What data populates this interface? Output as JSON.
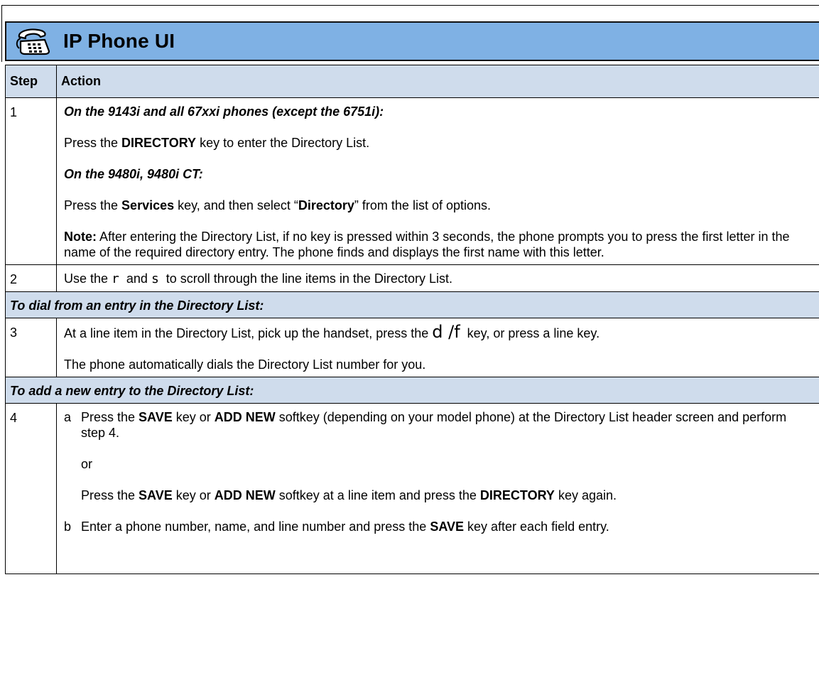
{
  "header": {
    "title": "IP Phone UI",
    "icon": "phone-icon",
    "background": "#7fb1e4"
  },
  "table": {
    "col_step": "Step",
    "col_action": "Action",
    "header_row_color": "#cfdcec"
  },
  "step1": {
    "num": "1",
    "models_a": "On the 9143i and all 67xxi phones (except the 6751i):",
    "press_a_pre": "Press the ",
    "press_a_key": "DIRECTORY",
    "press_a_post": " key to enter the Directory List.",
    "models_b": "On the 9480i, 9480i CT:",
    "press_b_pre": "Press the ",
    "press_b_key": "Services",
    "press_b_mid": " key, and then select “",
    "press_b_option": "Directory",
    "press_b_post": "” from the list of options.",
    "note_label": "Note:",
    "note_text": " After entering the Directory List, if no key is pressed within 3 seconds, the phone prompts you to press the first letter in the name of the required directory entry. The phone finds and displays the first name with this letter."
  },
  "step2": {
    "num": "2",
    "t1": "Use the ",
    "key_up": "r",
    "t2": "  and ",
    "key_down": "s",
    "t3": "  to scroll through the line items in the Directory List."
  },
  "section_dial": "To dial from an entry in the Directory List:",
  "step3": {
    "num": "3",
    "t1": "At a line item in the Directory List, pick up the handset, press the ",
    "key_glyph": "d /f",
    "t2": "  key, or press a line key.",
    "line2": "The phone automatically dials the Directory List number for you."
  },
  "section_add": "To add a new entry to the Directory List:",
  "step4": {
    "num": "4",
    "a_letter": "a",
    "a_t1": "Press the ",
    "a_key1": "SAVE",
    "a_t2": " key or ",
    "a_key2": "ADD NEW",
    "a_t3": " softkey (depending on your model phone) at the Directory List header screen and perform step 4.",
    "or": "or",
    "a2_t1": "Press the ",
    "a2_key1": "SAVE",
    "a2_t2": " key or ",
    "a2_key2": "ADD NEW",
    "a2_t3": " softkey at a line item and press the ",
    "a2_key3": "DIRECTORY",
    "a2_t4": " key again.",
    "b_letter": "b",
    "b_t1": "Enter a phone number, name, and line number and press the ",
    "b_key": "SAVE",
    "b_t2": " key after each field entry."
  }
}
